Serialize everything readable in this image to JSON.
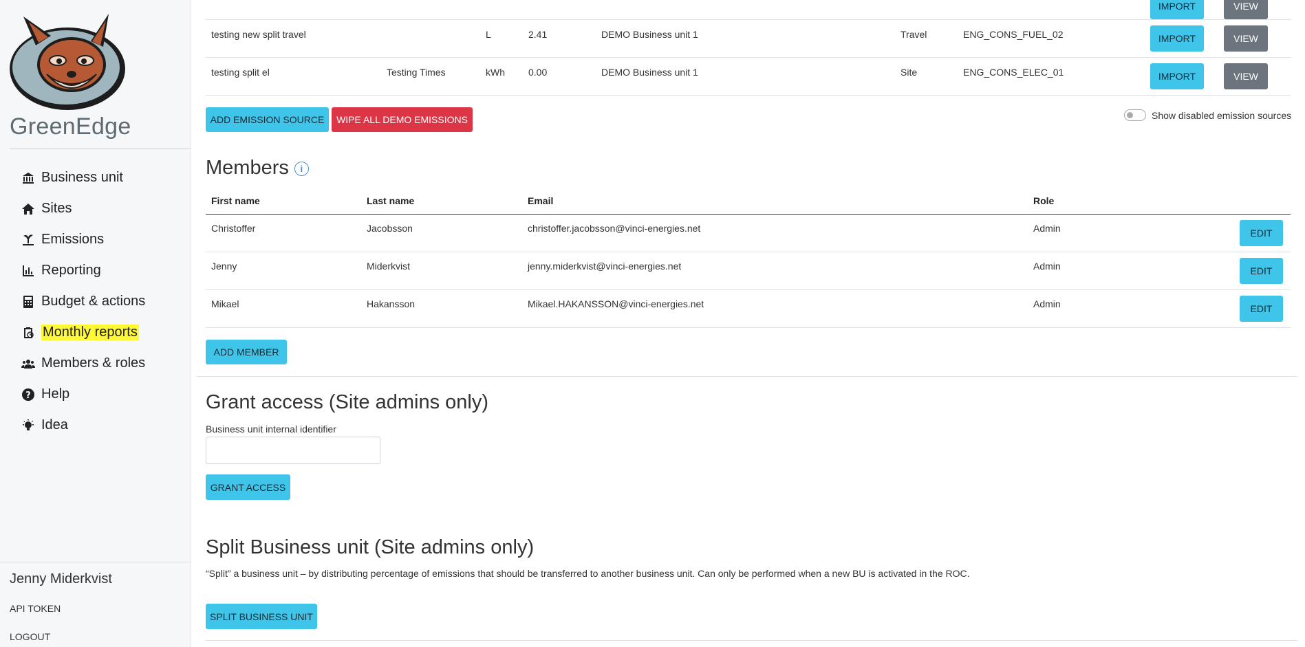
{
  "sidebar": {
    "brand": "GreenEdge",
    "nav": [
      {
        "label": "Business unit",
        "icon": "bank-icon"
      },
      {
        "label": "Sites",
        "icon": "home-icon"
      },
      {
        "label": "Emissions",
        "icon": "emissions-icon"
      },
      {
        "label": "Reporting",
        "icon": "bar-chart-icon"
      },
      {
        "label": "Budget & actions",
        "icon": "calculator-icon"
      },
      {
        "label": "Monthly reports",
        "icon": "clipboard-clock-icon",
        "highlight": "#fff837"
      },
      {
        "label": "Members & roles",
        "icon": "users-icon"
      },
      {
        "label": "Help",
        "icon": "question-circle-icon"
      },
      {
        "label": "Idea",
        "icon": "lightbulb-icon"
      }
    ],
    "user_name": "Jenny Miderkvist",
    "api_token": "API TOKEN",
    "logout": "LOGOUT"
  },
  "emissions": {
    "rows": [
      {
        "name": "",
        "description": "",
        "unit": "",
        "value": "",
        "business_unit": "",
        "category": "",
        "code": "",
        "import": "IMPORT",
        "view": "VIEW"
      },
      {
        "name": "testing new split travel",
        "description": "",
        "unit": "L",
        "value": "2.41",
        "business_unit": "DEMO Business unit 1",
        "category": "Travel",
        "code": "ENG_CONS_FUEL_02",
        "import": "IMPORT",
        "view": "VIEW"
      },
      {
        "name": "testing split el",
        "description": "Testing Times",
        "unit": "kWh",
        "value": "0.00",
        "business_unit": "DEMO Business unit 1",
        "category": "Site",
        "code": "ENG_CONS_ELEC_01",
        "import": "IMPORT",
        "view": "VIEW"
      }
    ],
    "add_button": "ADD EMISSION SOURCE",
    "wipe_button": "WIPE ALL DEMO EMISSIONS",
    "toggle_label": "Show disabled emission sources"
  },
  "members": {
    "title": "Members",
    "info": "i",
    "headers": {
      "first": "First name",
      "last": "Last name",
      "email": "Email",
      "role": "Role"
    },
    "rows": [
      {
        "first": "Christoffer",
        "last": "Jacobsson",
        "email": "christoffer.jacobsson@vinci-energies.net",
        "role": "Admin",
        "edit": "EDIT"
      },
      {
        "first": "Jenny",
        "last": "Miderkvist",
        "email": "jenny.miderkvist@vinci-energies.net",
        "role": "Admin",
        "edit": "EDIT"
      },
      {
        "first": "Mikael",
        "last": "Hakansson",
        "email": "Mikael.HAKANSSON@vinci-energies.net",
        "role": "Admin",
        "edit": "EDIT"
      }
    ],
    "add_button": "ADD MEMBER"
  },
  "grant": {
    "title": "Grant access (Site admins only)",
    "field_label": "Business unit internal identifier",
    "field_value": "",
    "button": "GRANT ACCESS"
  },
  "split": {
    "title": "Split Business unit (Site admins only)",
    "description": "“Split” a business unit – by distributing percentage of emissions that should be transferred to another business unit. Can only be performed when a new BU is activated in the ROC.",
    "button": "SPLIT BUSINESS UNIT"
  }
}
